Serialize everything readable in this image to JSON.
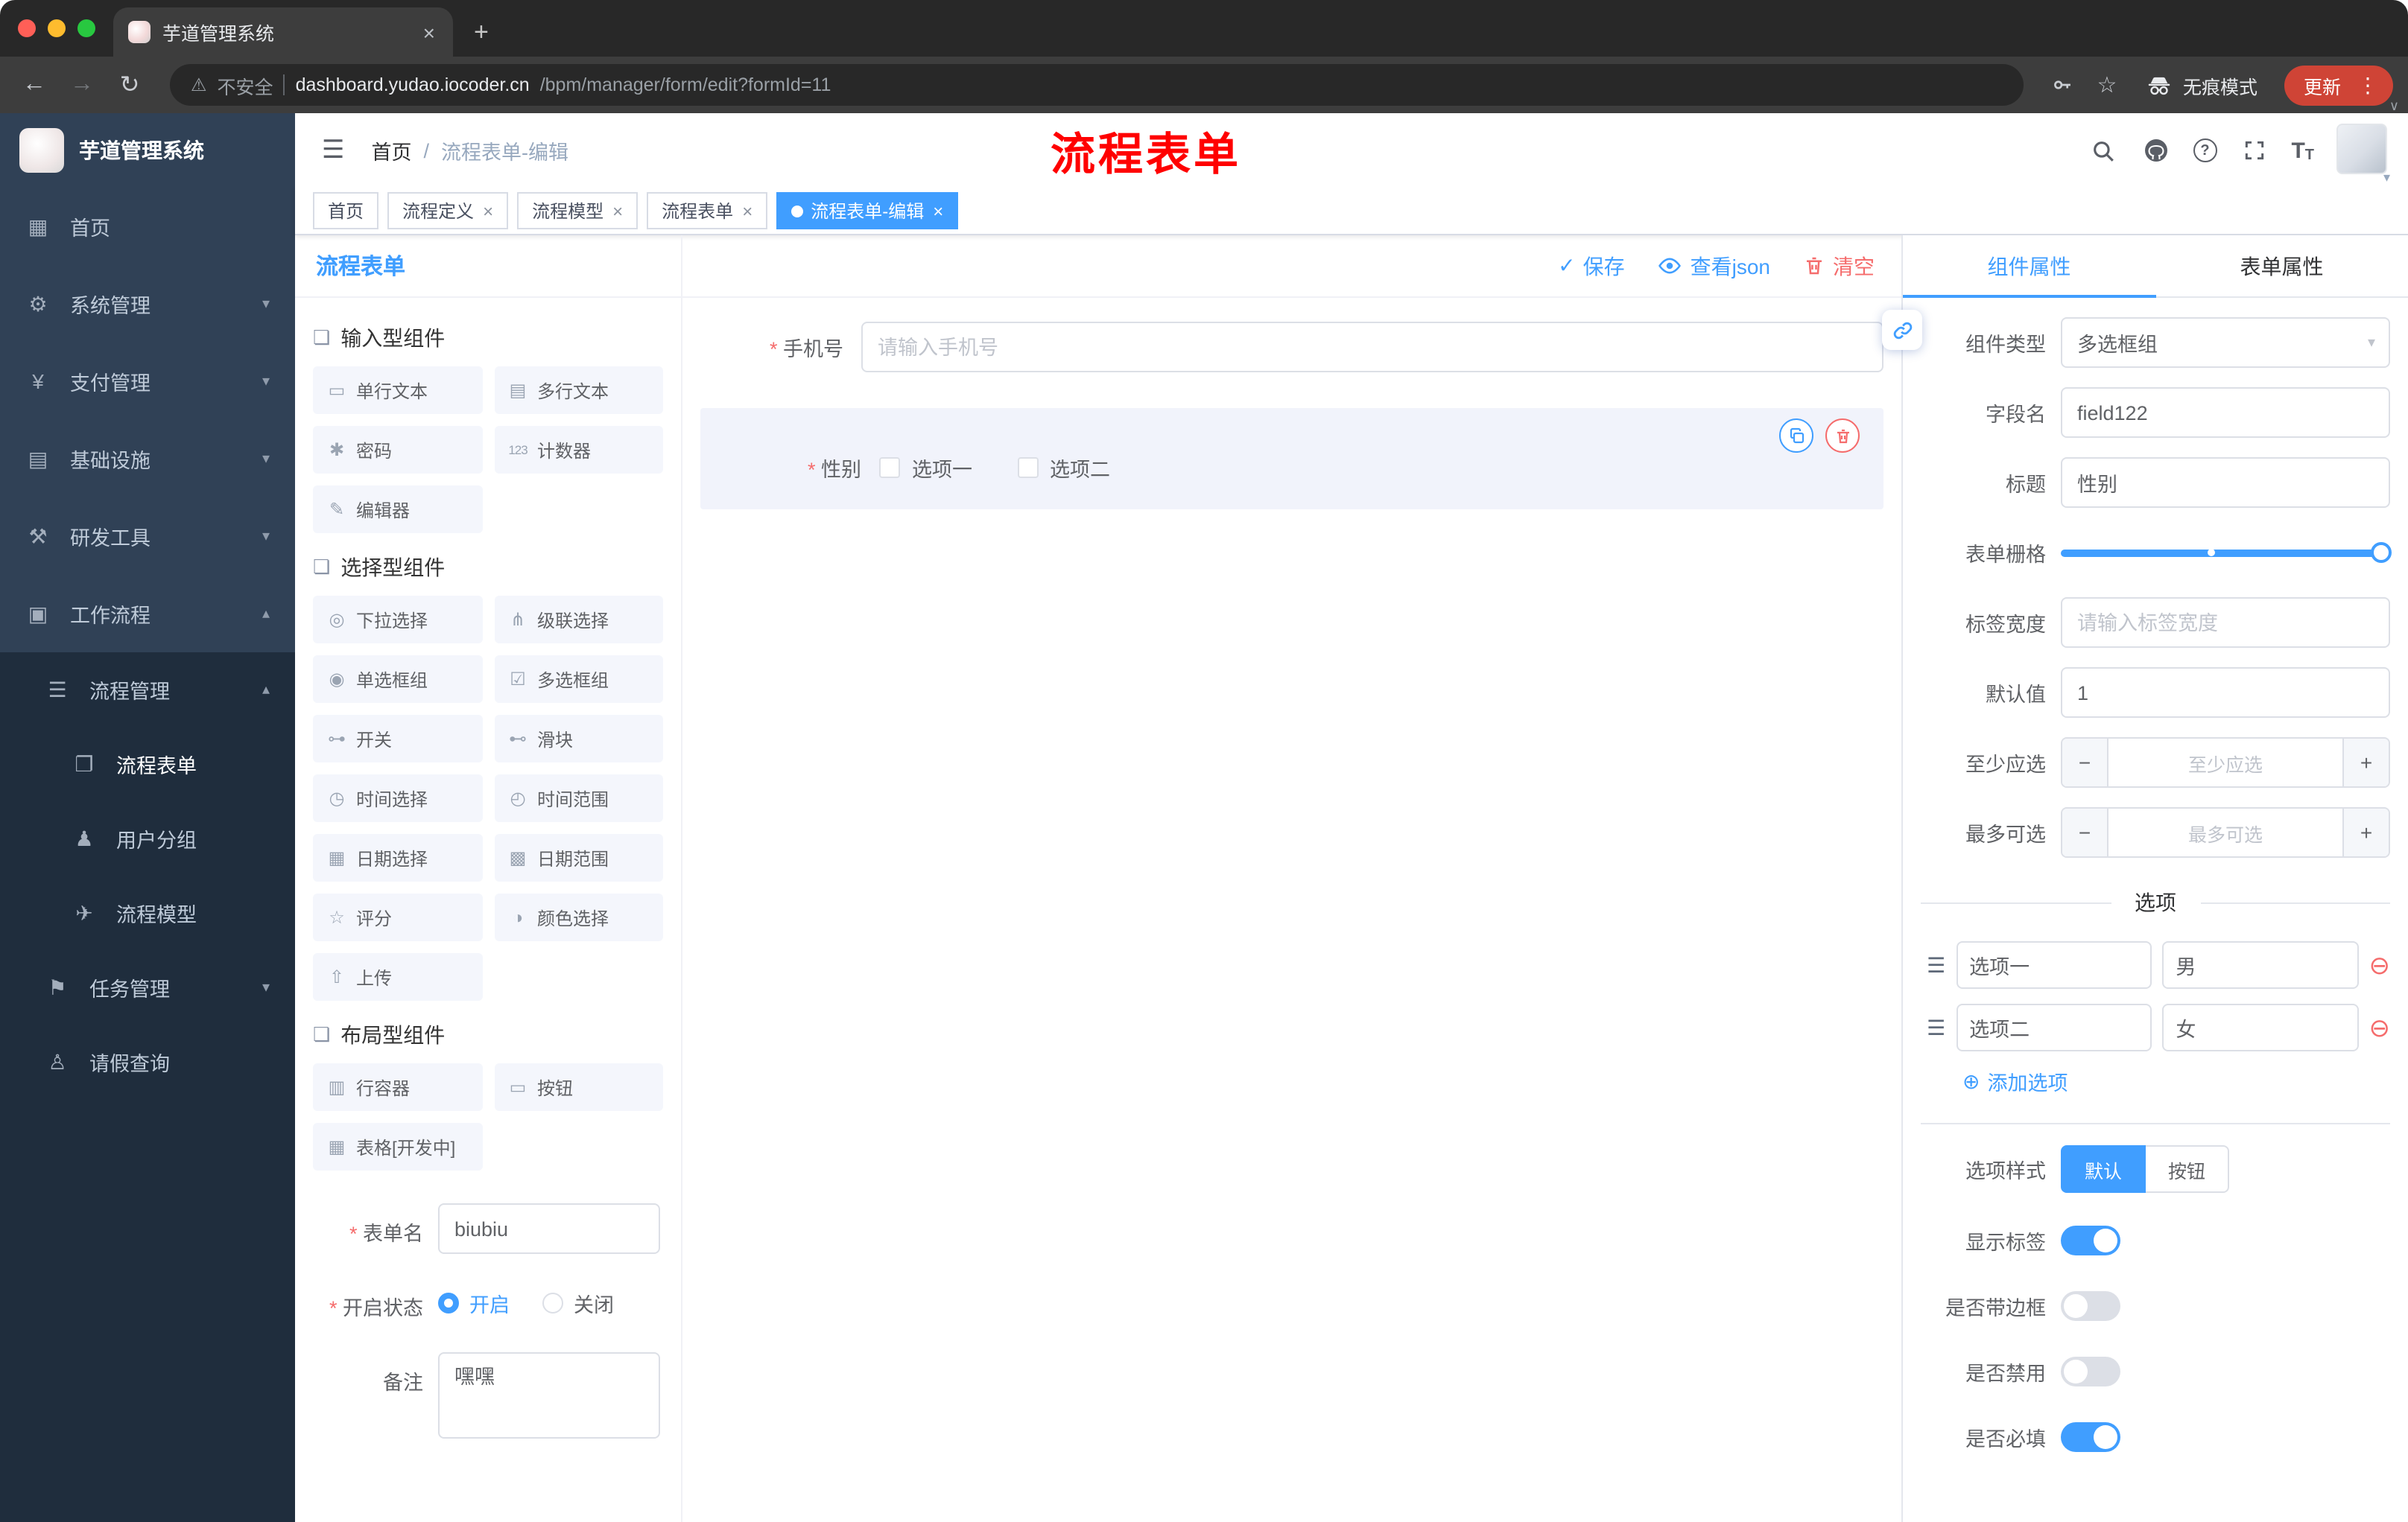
{
  "ui": {
    "close": "×",
    "caret_down": "▾",
    "check": "✓",
    "drag_handle": "☰",
    "remove_circle": "⊖",
    "add_circle": "⊕",
    "minus": "−",
    "plus": "+"
  },
  "browser": {
    "tab_title": "芋道管理系统",
    "new_tab": "+",
    "nav": {
      "back": "←",
      "forward": "→",
      "reload": "↻"
    },
    "security_icon": "⚠",
    "security_label": "不安全",
    "url_host": "dashboard.yudao.iocoder.cn",
    "url_path": "/bpm/manager/form/edit?formId=11",
    "star_icon": "☆",
    "incognito_label": "无痕模式",
    "update_label": "更新",
    "menu_dots": "⋮",
    "toolbar_caret": "∨"
  },
  "sidebar": {
    "logo_title": "芋道管理系统",
    "top_items": [
      {
        "icon": "▦",
        "label": "首页",
        "arrow": ""
      },
      {
        "icon": "⚙",
        "label": "系统管理",
        "arrow": "▾"
      },
      {
        "icon": "¥",
        "label": "支付管理",
        "arrow": "▾"
      },
      {
        "icon": "▤",
        "label": "基础设施",
        "arrow": "▾"
      },
      {
        "icon": "⚒",
        "label": "研发工具",
        "arrow": "▾"
      },
      {
        "icon": "▣",
        "label": "工作流程",
        "arrow": "▴"
      }
    ],
    "process_mgmt": {
      "icon": "☰",
      "label": "流程管理",
      "arrow": "▴"
    },
    "process_children": [
      {
        "icon": "❐",
        "label": "流程表单"
      },
      {
        "icon": "♟",
        "label": "用户分组"
      },
      {
        "icon": "✈",
        "label": "流程模型"
      }
    ],
    "task_mgmt": {
      "icon": "⚑",
      "label": "任务管理",
      "arrow": "▾"
    },
    "leave_query": {
      "icon": "♙",
      "label": "请假查询"
    }
  },
  "header": {
    "hamburger": "☰",
    "breadcrumb": {
      "home": "首页",
      "sep": "/",
      "current": "流程表单-编辑"
    },
    "annotation": "流程表单",
    "help_glyph": "?",
    "font_glyph": "T"
  },
  "tags": [
    {
      "label": "首页"
    },
    {
      "label": "流程定义"
    },
    {
      "label": "流程模型"
    },
    {
      "label": "流程表单"
    },
    {
      "label": "流程表单-编辑"
    }
  ],
  "designer": {
    "panel_title": "流程表单",
    "save_label": "保存",
    "view_json_label": "查看json",
    "clear_label": "清空",
    "section_icon": "❏",
    "sections": [
      {
        "title": "输入型组件",
        "items": [
          {
            "icon": "▭",
            "label": "单行文本"
          },
          {
            "icon": "▤",
            "label": "多行文本"
          },
          {
            "icon": "✱",
            "label": "密码"
          },
          {
            "icon": "123",
            "label": "计数器"
          },
          {
            "icon": "✎",
            "label": "编辑器"
          }
        ]
      },
      {
        "title": "选择型组件",
        "items": [
          {
            "icon": "◎",
            "label": "下拉选择"
          },
          {
            "icon": "⋔",
            "label": "级联选择"
          },
          {
            "icon": "◉",
            "label": "单选框组"
          },
          {
            "icon": "☑",
            "label": "多选框组"
          },
          {
            "icon": "⊶",
            "label": "开关"
          },
          {
            "icon": "⊷",
            "label": "滑块"
          },
          {
            "icon": "◷",
            "label": "时间选择"
          },
          {
            "icon": "◴",
            "label": "时间范围"
          },
          {
            "icon": "▦",
            "label": "日期选择"
          },
          {
            "icon": "▩",
            "label": "日期范围"
          },
          {
            "icon": "☆",
            "label": "评分"
          },
          {
            "icon": "◑",
            "label": "颜色选择"
          },
          {
            "icon": "⇧",
            "label": "上传"
          }
        ]
      },
      {
        "title": "布局型组件",
        "items": [
          {
            "icon": "▥",
            "label": "行容器"
          },
          {
            "icon": "▭",
            "label": "按钮"
          },
          {
            "icon": "▦",
            "label": "表格[开发中]"
          }
        ]
      }
    ],
    "meta": {
      "form_name_label": "表单名",
      "form_name_value": "biubiu",
      "status_label": "开启状态",
      "status_on": "开启",
      "status_off": "关闭",
      "remark_label": "备注",
      "remark_value": "嘿嘿"
    }
  },
  "canvas": {
    "phone_label": "手机号",
    "phone_placeholder": "请输入手机号",
    "gender_label": "性别",
    "gender_opt1": "选项一",
    "gender_opt2": "选项二"
  },
  "props": {
    "tab_component": "组件属性",
    "tab_form": "表单属性",
    "type_label": "组件类型",
    "type_value": "多选框组",
    "field_label": "字段名",
    "field_value": "field122",
    "title_label": "标题",
    "title_value": "性别",
    "grid_label": "表单栅格",
    "label_width_label": "标签宽度",
    "label_width_placeholder": "请输入标签宽度",
    "default_label": "默认值",
    "default_value": "1",
    "min_label": "至少应选",
    "min_placeholder": "至少应选",
    "max_label": "最多可选",
    "max_placeholder": "最多可选",
    "options_title": "选项",
    "options": [
      {
        "label": "选项一",
        "value": "男"
      },
      {
        "label": "选项二",
        "value": "女"
      }
    ],
    "add_option": "添加选项",
    "style_label": "选项样式",
    "style_default": "默认",
    "style_button": "按钮",
    "switch_show_label": "显示标签",
    "switch_border": "是否带边框",
    "switch_disabled": "是否禁用",
    "switch_required": "是否必填"
  }
}
